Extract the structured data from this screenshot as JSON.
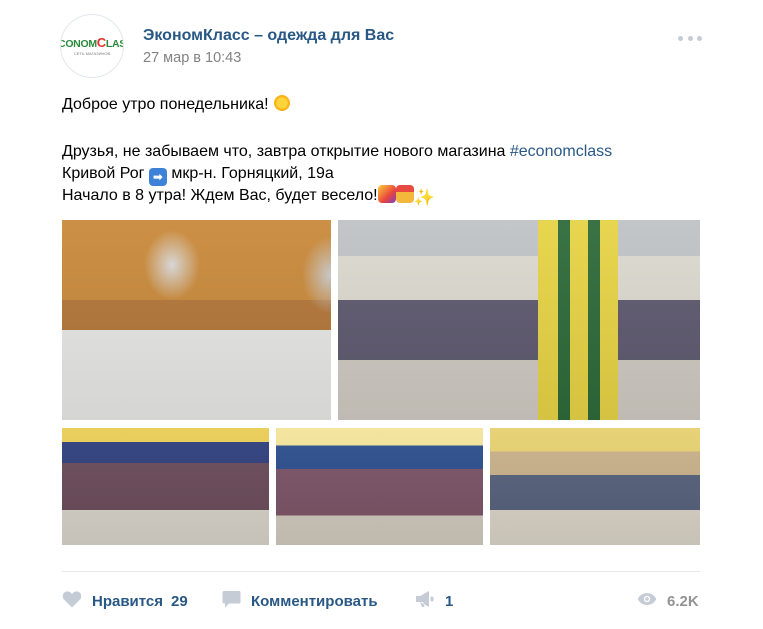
{
  "post": {
    "author": "ЭкономКласс – одежда для Вас",
    "date": "27 мар в 10:43",
    "avatar": {
      "logo_main": "ECONOM",
      "logo_accent": "C",
      "logo_tail": "LASS",
      "logo_sub": "СЕТЬ МАГАЗИНОВ"
    },
    "text": {
      "line1": "Доброе утро понедельника!",
      "line2_before": "Друзья, не забываем что, завтра открытие нового магазина ",
      "hashtag": "#economclass",
      "line3_before": "Кривой Рог ",
      "line3_after": " мкр-н. Горняцкий, 19а",
      "line4": "Начало в 8 утра! Ждем Вас, будет весело!"
    },
    "icons": {
      "sun": "sun-icon",
      "arrow": "right-arrow-icon",
      "party": "party-popper-icon",
      "gift": "gift-icon",
      "sparkles": "sparkles-icon"
    }
  },
  "photos": [
    "photo-refreshment-table",
    "photo-store-hall",
    "photo-clothing-racks",
    "photo-discount-hall",
    "photo-shelves-corner"
  ],
  "footer": {
    "like_label": "Нравится",
    "like_count": "29",
    "comment_label": "Комментировать",
    "share_count": "1",
    "views_count": "6.2K"
  },
  "colors": {
    "link": "#2a5885",
    "meta": "#828282",
    "icon": "#c5ccd6",
    "divider": "#e7e8ec"
  }
}
